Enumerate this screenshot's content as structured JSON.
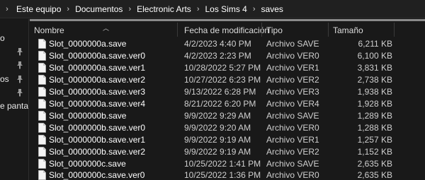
{
  "breadcrumb": {
    "items": [
      "Este equipo",
      "Documentos",
      "Electronic Arts",
      "Los Sims 4",
      "saves"
    ]
  },
  "nav": {
    "items": [
      {
        "label": "o",
        "pinned": false
      },
      {
        "label": "",
        "pinned": true
      },
      {
        "label": "",
        "pinned": true
      },
      {
        "label": "os",
        "pinned": true
      },
      {
        "label": "",
        "pinned": true
      },
      {
        "label": "e pantall",
        "pinned": false
      }
    ]
  },
  "columns": {
    "name": "Nombre",
    "date": "Fecha de modificación",
    "type": "Tipo",
    "size": "Tamaño"
  },
  "files": [
    {
      "name": "Slot_0000000a.save",
      "date": "4/2/2023 4:40 PM",
      "type": "Archivo SAVE",
      "size": "6,211 KB"
    },
    {
      "name": "Slot_0000000a.save.ver0",
      "date": "4/2/2023 2:23 PM",
      "type": "Archivo VER0",
      "size": "6,100 KB"
    },
    {
      "name": "Slot_0000000a.save.ver1",
      "date": "10/28/2022 5:27 PM",
      "type": "Archivo VER1",
      "size": "3,831 KB"
    },
    {
      "name": "Slot_0000000a.save.ver2",
      "date": "10/27/2022 6:23 PM",
      "type": "Archivo VER2",
      "size": "2,738 KB"
    },
    {
      "name": "Slot_0000000a.save.ver3",
      "date": "9/13/2022 6:28 PM",
      "type": "Archivo VER3",
      "size": "1,938 KB"
    },
    {
      "name": "Slot_0000000a.save.ver4",
      "date": "8/21/2022 6:20 PM",
      "type": "Archivo VER4",
      "size": "1,928 KB"
    },
    {
      "name": "Slot_0000000b.save",
      "date": "9/9/2022 9:29 AM",
      "type": "Archivo SAVE",
      "size": "1,289 KB"
    },
    {
      "name": "Slot_0000000b.save.ver0",
      "date": "9/9/2022 9:20 AM",
      "type": "Archivo VER0",
      "size": "1,288 KB"
    },
    {
      "name": "Slot_0000000b.save.ver1",
      "date": "9/9/2022 9:19 AM",
      "type": "Archivo VER1",
      "size": "1,257 KB"
    },
    {
      "name": "Slot_0000000b.save.ver2",
      "date": "9/9/2022 9:19 AM",
      "type": "Archivo VER2",
      "size": "1,152 KB"
    },
    {
      "name": "Slot_0000000c.save",
      "date": "10/25/2022 1:41 PM",
      "type": "Archivo SAVE",
      "size": "2,635 KB"
    },
    {
      "name": "Slot_0000000c.save.ver0",
      "date": "10/25/2022 1:36 PM",
      "type": "Archivo VER0",
      "size": "2,635 KB"
    }
  ],
  "colors": {
    "background": "#191919",
    "header_bar": "#202020",
    "text": "#ffffff",
    "muted_text": "#cfcfcf"
  }
}
